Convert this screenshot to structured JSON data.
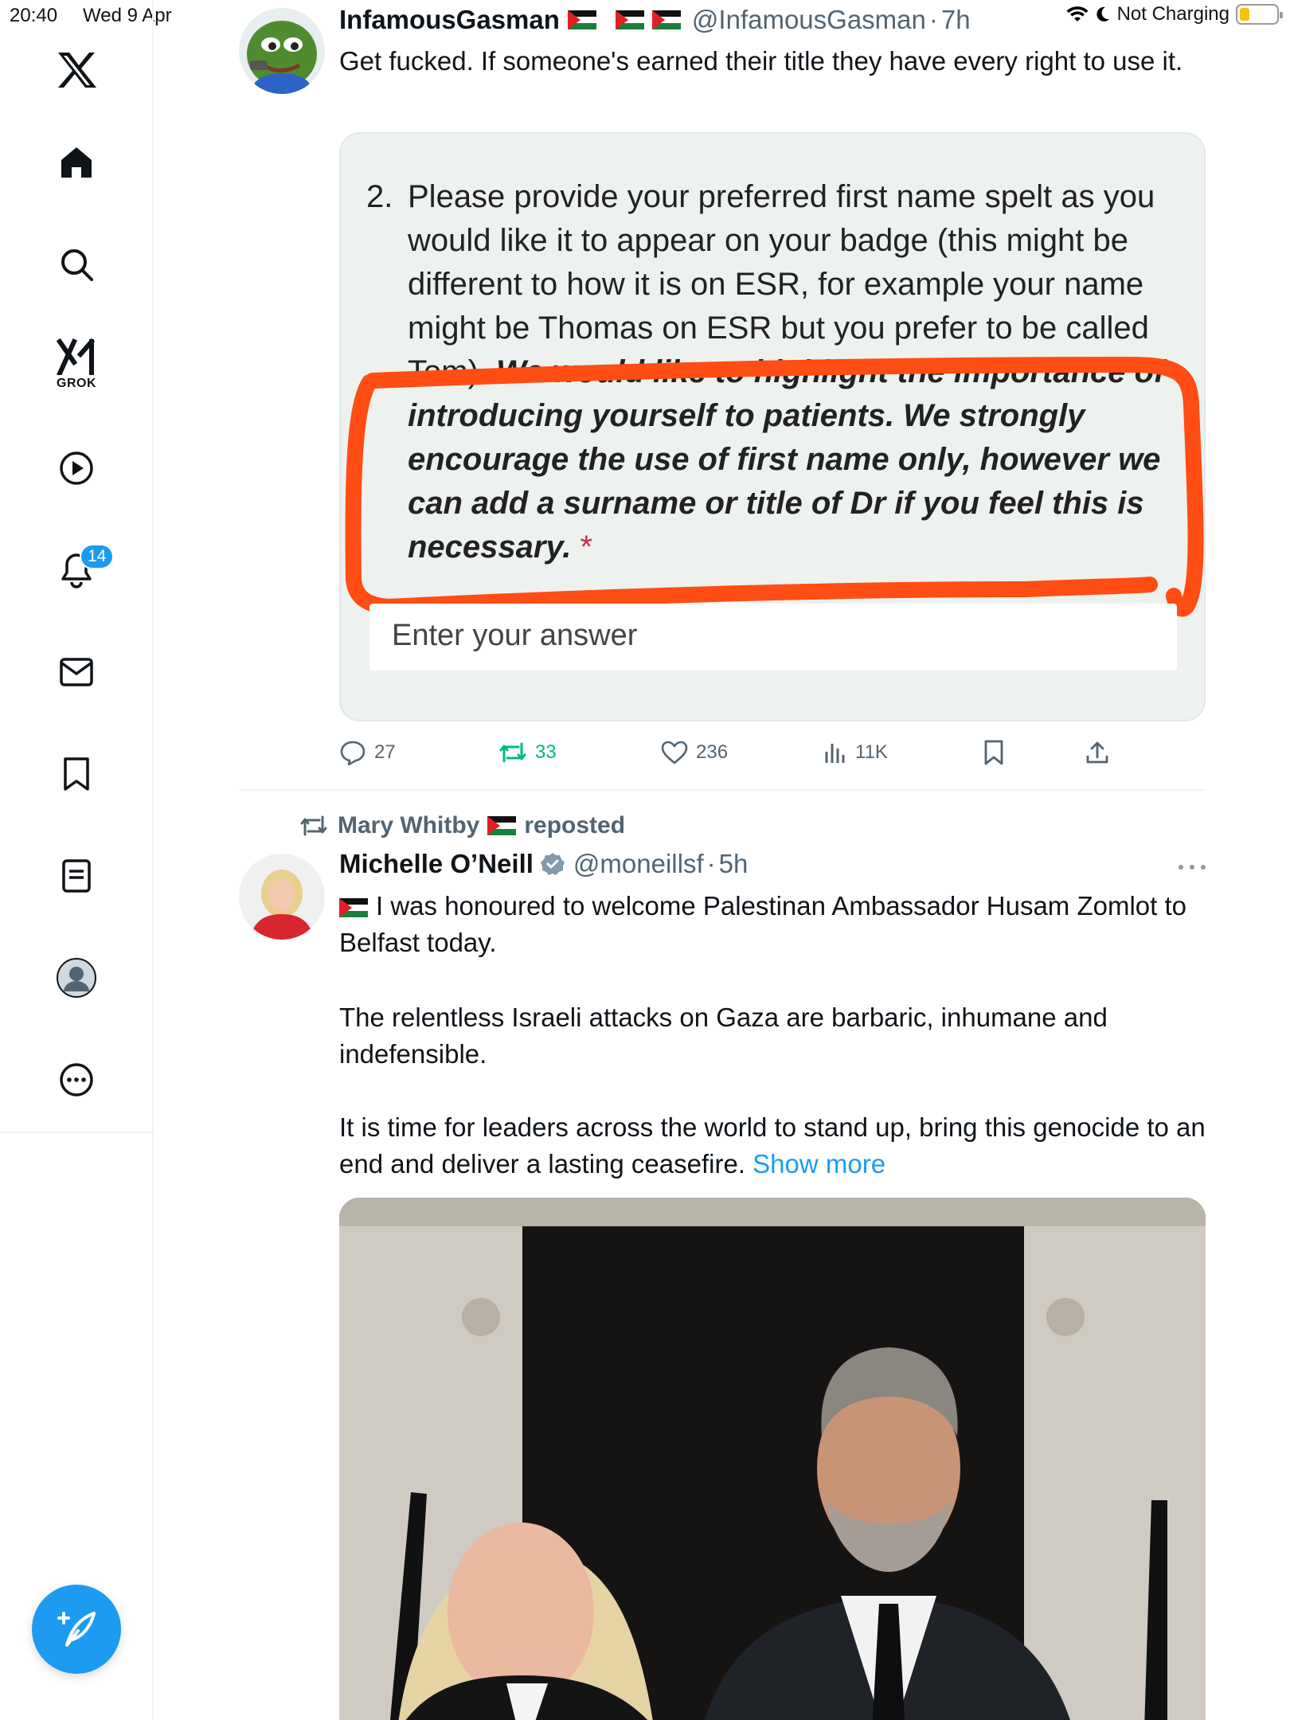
{
  "status_bar": {
    "time": "20:40",
    "date": "Wed 9 Apr",
    "charging": "Not Charging"
  },
  "sidebar": {
    "items": [
      {
        "name": "x-logo"
      },
      {
        "name": "home"
      },
      {
        "name": "search"
      },
      {
        "name": "grok",
        "label": "GROK"
      },
      {
        "name": "videos"
      },
      {
        "name": "notifications",
        "badge": "14"
      },
      {
        "name": "messages"
      },
      {
        "name": "bookmarks"
      },
      {
        "name": "lists"
      },
      {
        "name": "profile"
      },
      {
        "name": "more"
      }
    ],
    "compose_icon": "compose-post-icon"
  },
  "tweet1": {
    "display_name": "InfamousGasman",
    "handle": "@InfamousGasman",
    "time": "7h",
    "text": "Get fucked. If someone's earned their title they have every right to use it.",
    "form": {
      "number": "2.",
      "question_plain": "Please provide your preferred first name spelt as you would like it to appear on your badge (this might be different to how it is on ESR, for example your name might be Thomas on ESR but you prefer to be called Tom).",
      "question_emphasis": "We would like to highlight the importance of introducing yourself to patients. We strongly encourage the use of first name only, however we can add a surname or title of Dr if you feel this is necessary.",
      "required_mark": "*",
      "answer_placeholder": "Enter your answer"
    },
    "actions": {
      "replies": "27",
      "reposts": "33",
      "likes": "236",
      "views": "11K"
    }
  },
  "tweet2": {
    "reposted_by": "Mary Whitby",
    "reposted_label": "reposted",
    "display_name": "Michelle O’Neill",
    "handle": "@moneillsf",
    "time": "5h",
    "paragraph1": "I was honoured to welcome Palestinan Ambassador Husam Zomlot to Belfast today.",
    "paragraph2": "The relentless Israeli attacks on Gaza are barbaric, inhumane and indefensible.",
    "paragraph3": "It is time for leaders across the world to stand up, bring this genocide to an end and deliver a lasting ceasefire.",
    "show_more": "Show more"
  },
  "colors": {
    "accent": "#1d9bf0",
    "repost_green": "#00ba7c",
    "markup_orange": "#ff4d14",
    "secondary_text": "#536471"
  }
}
